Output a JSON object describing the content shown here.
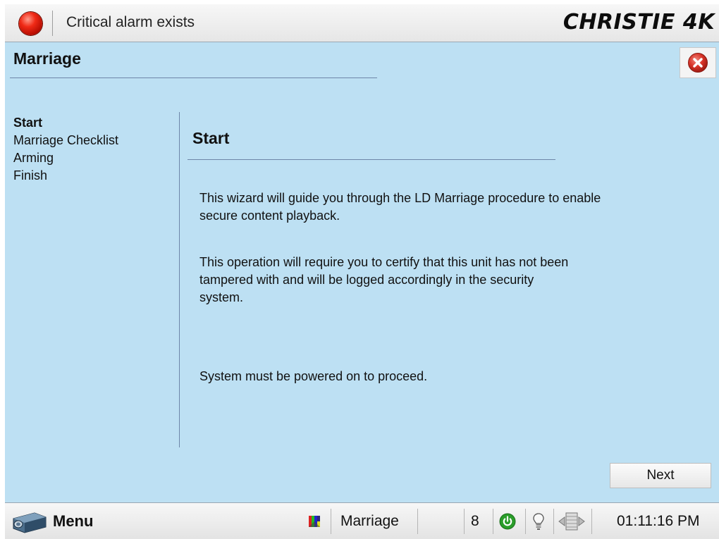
{
  "window": {
    "alarm_text": "Critical alarm exists",
    "brand": "CHRISTIE 4K",
    "page_title": "Marriage"
  },
  "steps": [
    {
      "label": "Start",
      "active": true
    },
    {
      "label": "Marriage Checklist",
      "active": false
    },
    {
      "label": "Arming",
      "active": false
    },
    {
      "label": "Finish",
      "active": false
    }
  ],
  "content": {
    "title": "Start",
    "paragraph_1": "This wizard will guide you through the LD Marriage procedure to enable secure content playback.",
    "paragraph_2": "This operation will require you to certify that this unit has not been tampered with and will be logged accordingly in the security system.",
    "paragraph_3": "System must be powered on to proceed.",
    "next_label": "Next"
  },
  "taskbar": {
    "menu_label": "Menu",
    "current_page": "Marriage",
    "channel": "8",
    "time": "01:11:16 PM"
  },
  "icons": {
    "alarm": "alarm-led-icon",
    "close": "close-icon",
    "menu": "projector-icon",
    "test_pattern": "test-pattern-icon",
    "power": "power-icon",
    "lamp": "lamp-icon",
    "dowser": "dowser-icon"
  },
  "colors": {
    "background": "#bde0f3",
    "alarm_red": "#e02a16",
    "power_green": "#2a9d2a",
    "close_red": "#d9352a",
    "divider": "#6d86a8"
  }
}
